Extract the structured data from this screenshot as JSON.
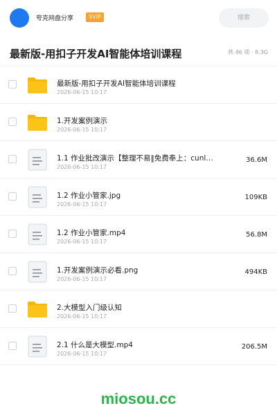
{
  "header": {
    "app_name": "夸克网盘分享",
    "badge": "SVIP",
    "search_label": "搜索"
  },
  "share": {
    "title": "最新版-用扣子开发AI智能体培训课程",
    "meta": "共 46 项 · 8.3G"
  },
  "files": [
    {
      "type": "folder",
      "name": "最新版-用扣子开发AI智能体培训课程",
      "date": "2026-06-15 10:17",
      "size": ""
    },
    {
      "type": "folder",
      "name": "1.开发案例演示",
      "date": "2026-06-15 10:17",
      "size": ""
    },
    {
      "type": "file",
      "name": "1.1 作业批改演示【整理不易‖免费奉上：cunl…",
      "date": "2026-06-15 10:17",
      "size": "36.6M"
    },
    {
      "type": "file",
      "name": "1.2 作业小管家.jpg",
      "date": "2026-06-15 10:17",
      "size": "109KB"
    },
    {
      "type": "file",
      "name": "1.2 作业小管家.mp4",
      "date": "2026-06-15 10:17",
      "size": "56.8M"
    },
    {
      "type": "file",
      "name": "1.开发案例演示必看.png",
      "date": "2026-06-15 10:17",
      "size": "494KB"
    },
    {
      "type": "folder",
      "name": "2.大模型入门级认知",
      "date": "2026-06-15 10:17",
      "size": ""
    },
    {
      "type": "file",
      "name": "2.1 什么是大模型.mp4",
      "date": "2026-06-15 10:17",
      "size": "206.5M"
    }
  ],
  "footer": {
    "brand": "miosou.cc"
  },
  "colors": {
    "accent": "#1f7af0",
    "svip": "#f7a233",
    "folder": "#fcc419",
    "brand": "#2db34a"
  }
}
